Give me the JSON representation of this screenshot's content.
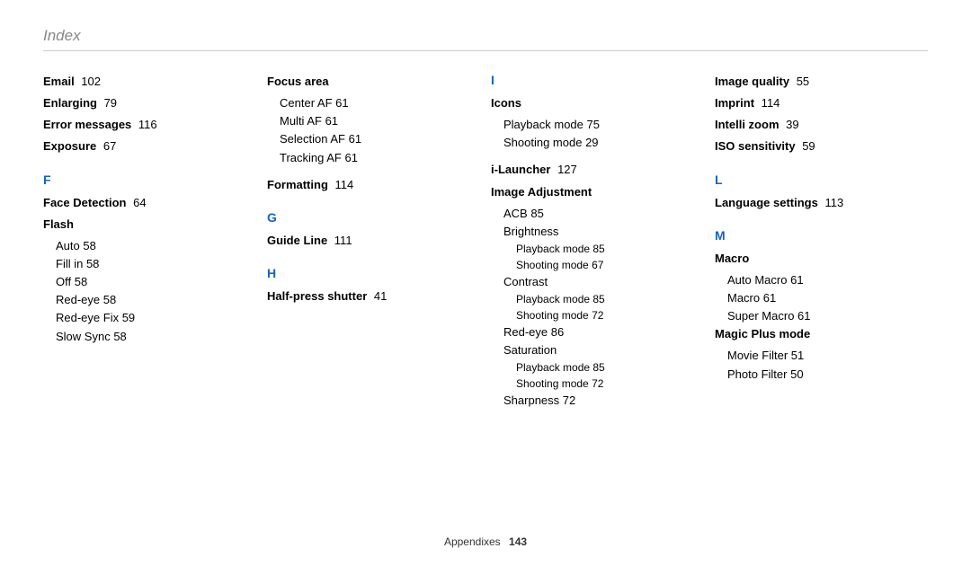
{
  "title": "Index",
  "footer": {
    "section": "Appendixes",
    "page": "143"
  },
  "columns": [
    [
      {
        "type": "bold",
        "text": "Email",
        "page": "102"
      },
      {
        "type": "bold",
        "text": "Enlarging",
        "page": "79"
      },
      {
        "type": "bold",
        "text": "Error messages",
        "page": "116"
      },
      {
        "type": "bold",
        "text": "Exposure",
        "page": "67"
      },
      {
        "type": "letter",
        "text": "F"
      },
      {
        "type": "bold",
        "text": "Face Detection",
        "page": "64"
      },
      {
        "type": "bold",
        "text": "Flash"
      },
      {
        "type": "sub",
        "text": "Auto",
        "page": "58"
      },
      {
        "type": "sub",
        "text": "Fill in",
        "page": "58"
      },
      {
        "type": "sub",
        "text": "Off",
        "page": "58"
      },
      {
        "type": "sub",
        "text": "Red-eye",
        "page": "58"
      },
      {
        "type": "sub",
        "text": "Red-eye Fix",
        "page": "59"
      },
      {
        "type": "sub",
        "text": "Slow Sync",
        "page": "58"
      }
    ],
    [
      {
        "type": "bold",
        "text": "Focus area"
      },
      {
        "type": "sub",
        "text": "Center AF",
        "page": "61"
      },
      {
        "type": "sub",
        "text": "Multi AF",
        "page": "61"
      },
      {
        "type": "sub",
        "text": "Selection AF",
        "page": "61"
      },
      {
        "type": "sub",
        "text": "Tracking AF",
        "page": "61"
      },
      {
        "type": "bold",
        "text": "Formatting",
        "page": "114",
        "gapBefore": true
      },
      {
        "type": "letter",
        "text": "G"
      },
      {
        "type": "bold",
        "text": "Guide Line",
        "page": "111"
      },
      {
        "type": "letter",
        "text": "H"
      },
      {
        "type": "bold",
        "text": "Half-press shutter",
        "page": "41"
      }
    ],
    [
      {
        "type": "letter",
        "text": "I",
        "noTopGap": true
      },
      {
        "type": "bold",
        "text": "Icons"
      },
      {
        "type": "sub",
        "text": "Playback mode",
        "page": "75"
      },
      {
        "type": "sub",
        "text": "Shooting mode",
        "page": "29"
      },
      {
        "type": "bold",
        "text": "i-Launcher",
        "page": "127",
        "gapBefore": true
      },
      {
        "type": "bold",
        "text": "Image Adjustment"
      },
      {
        "type": "sub",
        "text": "ACB",
        "page": "85"
      },
      {
        "type": "sub",
        "text": "Brightness"
      },
      {
        "type": "sub2",
        "text": "Playback mode",
        "page": "85"
      },
      {
        "type": "sub2",
        "text": "Shooting mode",
        "page": "67"
      },
      {
        "type": "sub",
        "text": "Contrast"
      },
      {
        "type": "sub2",
        "text": "Playback mode",
        "page": "85"
      },
      {
        "type": "sub2",
        "text": "Shooting mode",
        "page": "72"
      },
      {
        "type": "sub",
        "text": "Red-eye",
        "page": "86"
      },
      {
        "type": "sub",
        "text": "Saturation"
      },
      {
        "type": "sub2",
        "text": "Playback mode",
        "page": "85"
      },
      {
        "type": "sub2",
        "text": "Shooting mode",
        "page": "72"
      },
      {
        "type": "sub",
        "text": "Sharpness",
        "page": "72"
      }
    ],
    [
      {
        "type": "bold",
        "text": "Image quality",
        "page": "55"
      },
      {
        "type": "bold",
        "text": "Imprint",
        "page": "114"
      },
      {
        "type": "bold",
        "text": "Intelli zoom",
        "page": "39"
      },
      {
        "type": "bold",
        "text": "ISO sensitivity",
        "page": "59"
      },
      {
        "type": "letter",
        "text": "L"
      },
      {
        "type": "bold",
        "text": "Language settings",
        "page": "113"
      },
      {
        "type": "letter",
        "text": "M"
      },
      {
        "type": "bold",
        "text": "Macro"
      },
      {
        "type": "sub",
        "text": "Auto Macro",
        "page": "61"
      },
      {
        "type": "sub",
        "text": "Macro",
        "page": "61"
      },
      {
        "type": "sub",
        "text": "Super Macro",
        "page": "61"
      },
      {
        "type": "bold",
        "text": "Magic Plus mode"
      },
      {
        "type": "sub",
        "text": "Movie Filter",
        "page": "51"
      },
      {
        "type": "sub",
        "text": "Photo Filter",
        "page": "50"
      }
    ]
  ]
}
